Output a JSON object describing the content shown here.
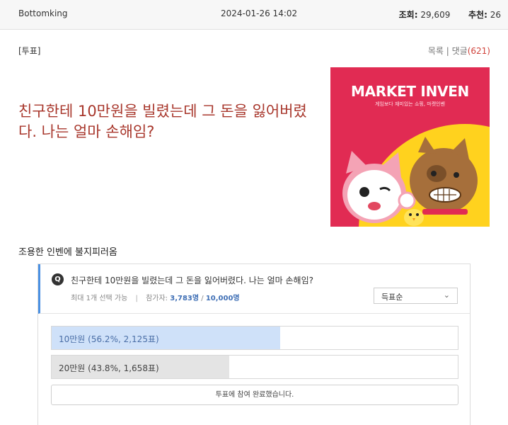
{
  "header": {
    "author": "Bottomking",
    "date": "2024-01-26 14:02",
    "views_label": "조회:",
    "views_value": "29,609",
    "recommend_label": "추천:",
    "recommend_value": "26"
  },
  "post": {
    "category": "[투표]",
    "list_link": "목록",
    "link_separator": "|",
    "comments_link": "댓글",
    "comments_count": "(621)",
    "title": "친구한테 10만원을 빌렸는데 그 돈을 잃어버렸다. 나는 얼마 손해임?",
    "body": "조용한 인벤에 불지피러옴"
  },
  "banner": {
    "logo_text": "MARKET INVEN",
    "tagline": "게임보다 재미있는 쇼핑, 마켓인벤"
  },
  "poll": {
    "q_badge": "Q",
    "question": "친구한테 10만원을 빌렸는데 그 돈을 잃어버렸다. 나는 얼마 손해임?",
    "select_info": "최대 1개 선택 가능",
    "meta_separator": "|",
    "participants_label": "참가자:",
    "participants": "3,783명",
    "participants_separator": "/",
    "capacity": "10,000명",
    "sort_label": "득표순",
    "options": [
      {
        "label": "10만원 (56.2%, 2,125표)",
        "share": 0.562,
        "color": "#cfe1f9"
      },
      {
        "label": "20만원 (43.8%, 1,658표)",
        "share": 0.438,
        "color": "#e4e4e4"
      }
    ],
    "done_label": "투표에 참여 완료했습니다."
  },
  "icons": {
    "chevron": "chevron-down-icon",
    "question": "q-badge-icon"
  },
  "colors": {
    "title": "#a8372c",
    "accent_blue": "#4a90e2",
    "banner_bg": "#e12b53",
    "comment_count": "#d0433b"
  }
}
